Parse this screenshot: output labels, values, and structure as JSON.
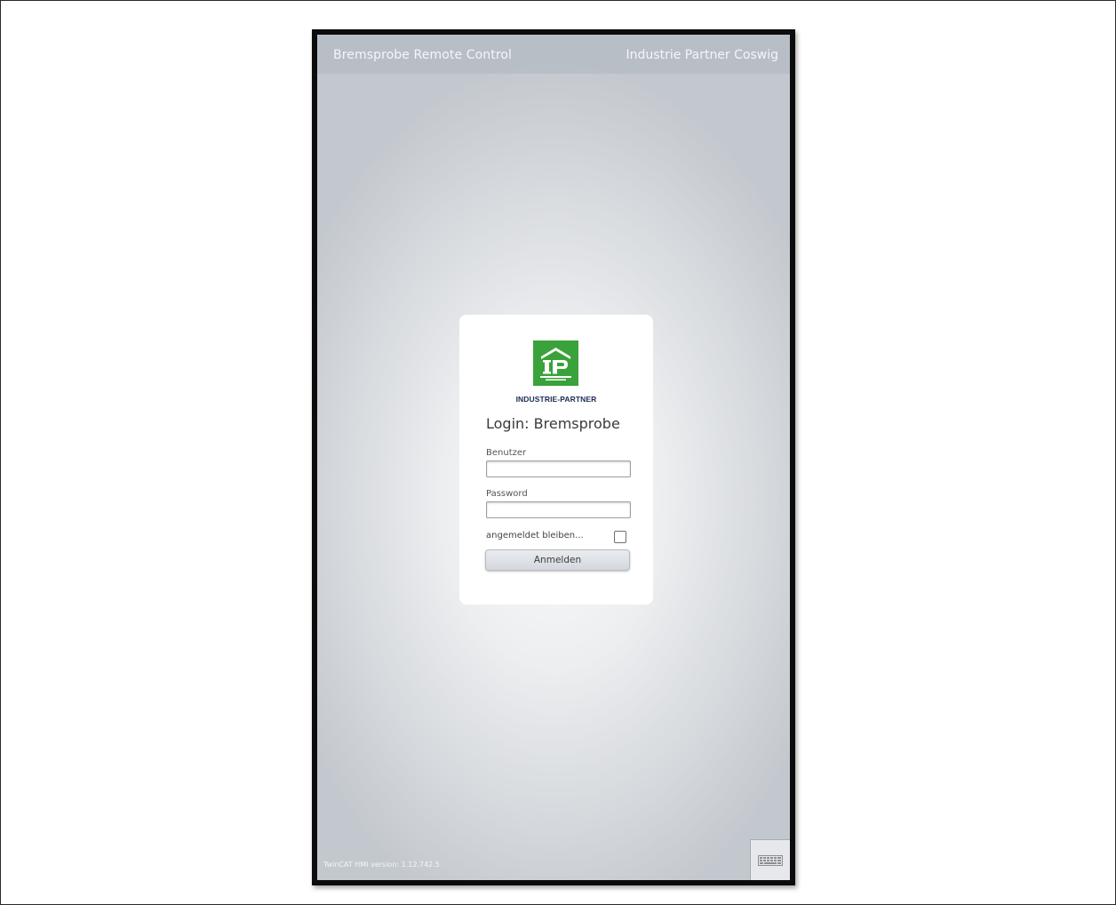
{
  "app": {
    "title": "Bremsprobe Remote Control",
    "company": "Industrie Partner Coswig"
  },
  "login": {
    "logo_brand": "INDUSTRIE-PARTNER",
    "logo_letters": "IP",
    "title": "Login: Bremsprobe",
    "user_label": "Benutzer",
    "user_value": "",
    "password_label": "Password",
    "password_value": "",
    "remember_label": "angemeldet bleiben...",
    "remember_checked": false,
    "submit_label": "Anmelden"
  },
  "footer": {
    "version": "TwinCAT HMI version: 1.12.742.5",
    "keyboard_icon": "keyboard-icon"
  },
  "colors": {
    "logo_green": "#3aa23a",
    "brand_navy": "#1b2b55",
    "device_bezel": "#0c0c0c"
  }
}
